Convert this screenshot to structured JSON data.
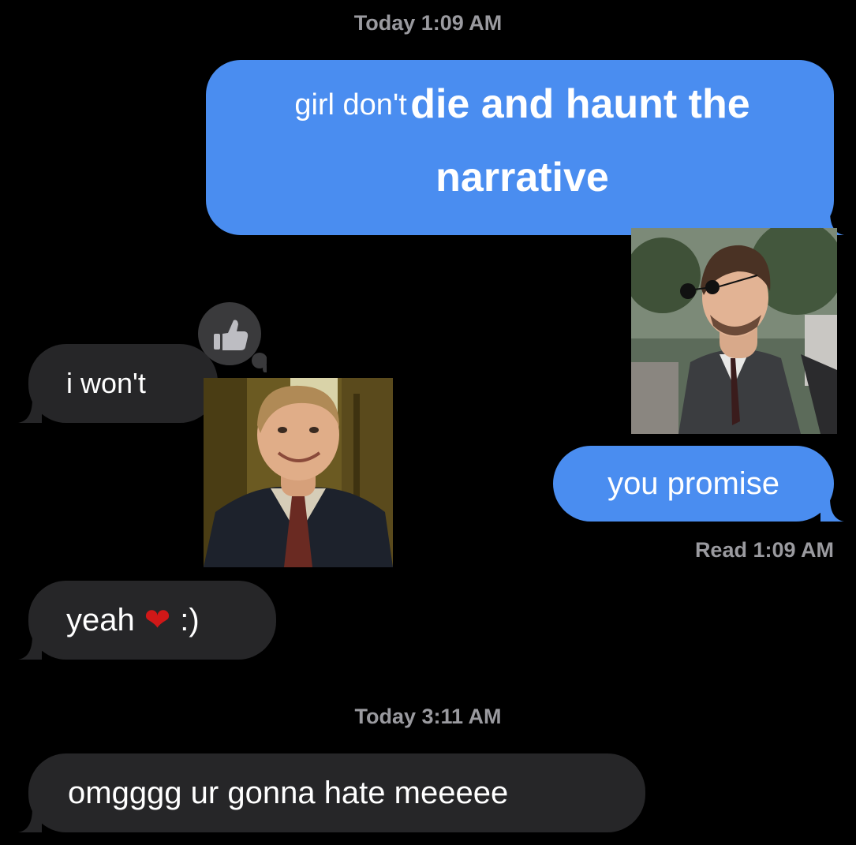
{
  "timestamps": {
    "first": "Today 1:09 AM",
    "second": "Today 3:11 AM"
  },
  "messages": {
    "outgoing_1": {
      "part_small": "girl don't",
      "part_big_line1": "die and haunt the",
      "part_big_line2": "narrative"
    },
    "incoming_1": {
      "text": "i won't"
    },
    "outgoing_2": {
      "text": "you promise"
    },
    "incoming_2": {
      "text_before": "yeah",
      "emoji": "heart",
      "text_after": ":)"
    },
    "incoming_3": {
      "text": "omgggg ur gonna hate meeeee"
    }
  },
  "read_receipt": "Read 1:09 AM",
  "tapback": {
    "icon": "thumbs-up-icon"
  },
  "photos": {
    "right": {
      "subject": "man-with-round-sunglasses-photo"
    },
    "left": {
      "subject": "smiling-man-in-suit-photo"
    }
  },
  "colors": {
    "background": "#000000",
    "outgoing_bubble": "#4a8df0",
    "incoming_bubble": "#262628",
    "timestamp": "#9a9a9f"
  }
}
